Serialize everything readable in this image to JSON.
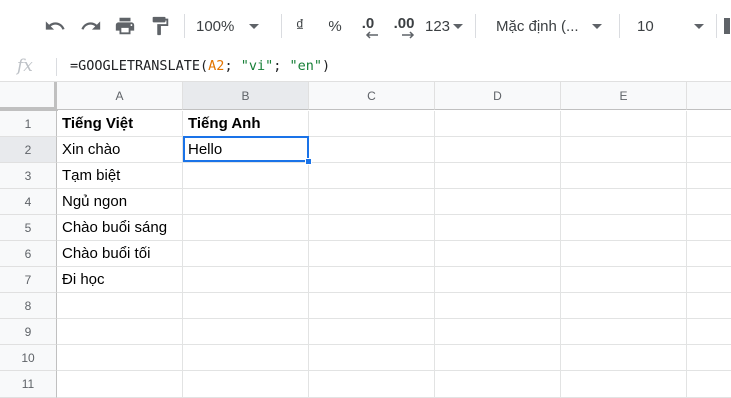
{
  "toolbar": {
    "zoom": "100%",
    "currency": "₫",
    "percent": "%",
    "decrease_decimal": ".0",
    "increase_decimal": ".00",
    "number_format": "123",
    "font": "Mặc định (...",
    "font_size": "10"
  },
  "formula_bar": {
    "fx_label": "fx",
    "formula_prefix": "=GOOGLETRANSLATE(",
    "formula_ref": "A2",
    "formula_sep1": "; ",
    "formula_arg1": "\"vi\"",
    "formula_sep2": "; ",
    "formula_arg2": "\"en\"",
    "formula_suffix": ")"
  },
  "grid": {
    "columns": [
      "A",
      "B",
      "C",
      "D",
      "E"
    ],
    "rows": [
      "1",
      "2",
      "3",
      "4",
      "5",
      "6",
      "7",
      "8",
      "9",
      "10",
      "11"
    ],
    "active_cell": "B2",
    "cells": {
      "A1": "Tiếng Việt",
      "B1": "Tiếng Anh",
      "A2": "Xin chào",
      "B2": "Hello",
      "A3": "Tạm biệt",
      "A4": "Ngủ ngon",
      "A5": "Chào buổi sáng",
      "A6": "Chào buổi tối",
      "A7": "Đi học"
    }
  },
  "colors": {
    "selection": "#1a73e8",
    "formula_ref": "#e37400",
    "formula_string": "#188038"
  }
}
